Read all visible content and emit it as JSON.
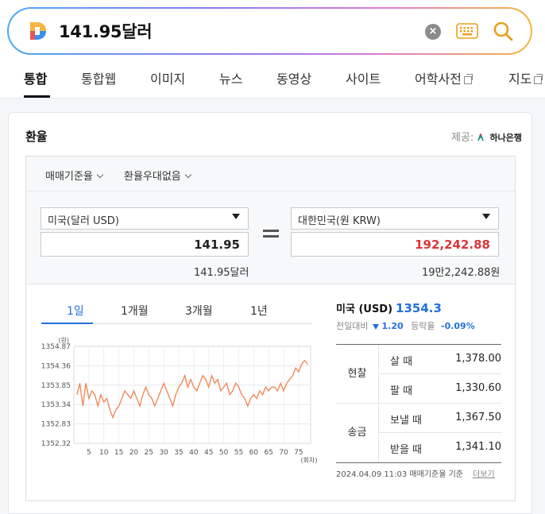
{
  "search": {
    "query": "141.95달러",
    "clear_icon": "close-circle-icon",
    "keyboard_icon": "keyboard-icon",
    "search_icon": "search-icon",
    "logo_colors": [
      "#3a8ef0",
      "#f4b640",
      "#e8554e"
    ]
  },
  "tabs": [
    {
      "label": "통합",
      "active": true
    },
    {
      "label": "통합웹"
    },
    {
      "label": "이미지"
    },
    {
      "label": "뉴스"
    },
    {
      "label": "동영상"
    },
    {
      "label": "사이트"
    },
    {
      "label": "어학사전"
    },
    {
      "label": "지도"
    }
  ],
  "card": {
    "title": "환율",
    "provider_label": "제공:",
    "provider_name": "하나은행"
  },
  "filters": [
    "매매기준율",
    "환율우대없음"
  ],
  "converter": {
    "from_currency": "미국(달러 USD)",
    "from_amount": "141.95",
    "from_words": "141.95달러",
    "to_currency": "대한민국(원 KRW)",
    "to_amount": "192,242.88",
    "to_words": "19만2,242.88원"
  },
  "period_tabs": [
    {
      "label": "1일",
      "active": true
    },
    {
      "label": "1개월"
    },
    {
      "label": "3개월"
    },
    {
      "label": "1년"
    }
  ],
  "rate": {
    "country": "미국 (USD)",
    "value": "1354.3",
    "change_label": "전일대비",
    "change": "1.20",
    "pct_label": "등락율",
    "pct": "-0.09%",
    "groups": [
      {
        "label": "현찰",
        "rows": [
          {
            "k": "살 때",
            "v": "1,378.00"
          },
          {
            "k": "팔 때",
            "v": "1,330.60"
          }
        ]
      },
      {
        "label": "송금",
        "rows": [
          {
            "k": "보낼 때",
            "v": "1,367.50"
          },
          {
            "k": "받을 때",
            "v": "1,341.10"
          }
        ]
      }
    ],
    "basis": "2024.04.09 11:03  매매기준율 기준",
    "more": "더보기"
  },
  "chart_data": {
    "type": "line",
    "ylabel": "(원)",
    "xlabel": "(회차)",
    "yticks": [
      "1354.87",
      "1354.36",
      "1353.85",
      "1353.34",
      "1352.83",
      "1352.32"
    ],
    "xticks": [
      "5",
      "10",
      "15",
      "20",
      "25",
      "30",
      "35",
      "40",
      "45",
      "50",
      "55",
      "60",
      "65",
      "70",
      "75"
    ],
    "ylim": [
      1352.32,
      1354.87
    ],
    "xlim": [
      0,
      79
    ],
    "grid": true,
    "color": "#f08a5d",
    "x": [
      1,
      2,
      3,
      4,
      5,
      6,
      7,
      8,
      9,
      10,
      11,
      12,
      13,
      14,
      15,
      16,
      17,
      18,
      19,
      20,
      21,
      22,
      23,
      24,
      25,
      26,
      27,
      28,
      29,
      30,
      31,
      32,
      33,
      34,
      35,
      36,
      37,
      38,
      39,
      40,
      41,
      42,
      43,
      44,
      45,
      46,
      47,
      48,
      49,
      50,
      51,
      52,
      53,
      54,
      55,
      56,
      57,
      58,
      59,
      60,
      61,
      62,
      63,
      64,
      65,
      66,
      67,
      68,
      69,
      70,
      71,
      72,
      73,
      74,
      75,
      76,
      77,
      78
    ],
    "y": [
      1353.6,
      1353.9,
      1353.3,
      1353.9,
      1353.5,
      1353.7,
      1353.6,
      1353.3,
      1353.6,
      1353.4,
      1353.5,
      1353.2,
      1353.0,
      1353.2,
      1353.3,
      1353.5,
      1353.7,
      1353.6,
      1353.5,
      1353.7,
      1353.5,
      1353.3,
      1353.6,
      1353.8,
      1353.6,
      1353.5,
      1353.3,
      1353.5,
      1353.7,
      1353.9,
      1353.7,
      1353.5,
      1353.3,
      1353.6,
      1353.8,
      1353.9,
      1354.1,
      1353.8,
      1354.0,
      1353.8,
      1353.7,
      1353.9,
      1354.1,
      1354.0,
      1353.8,
      1354.1,
      1353.9,
      1354.0,
      1353.7,
      1353.8,
      1353.9,
      1353.6,
      1353.7,
      1353.9,
      1353.8,
      1353.6,
      1353.5,
      1353.3,
      1353.5,
      1353.6,
      1353.5,
      1353.7,
      1353.6,
      1353.8,
      1353.7,
      1353.8,
      1353.8,
      1353.7,
      1353.9,
      1353.7,
      1353.9,
      1354.0,
      1354.1,
      1354.3,
      1354.2,
      1354.4,
      1354.5,
      1354.4
    ]
  }
}
